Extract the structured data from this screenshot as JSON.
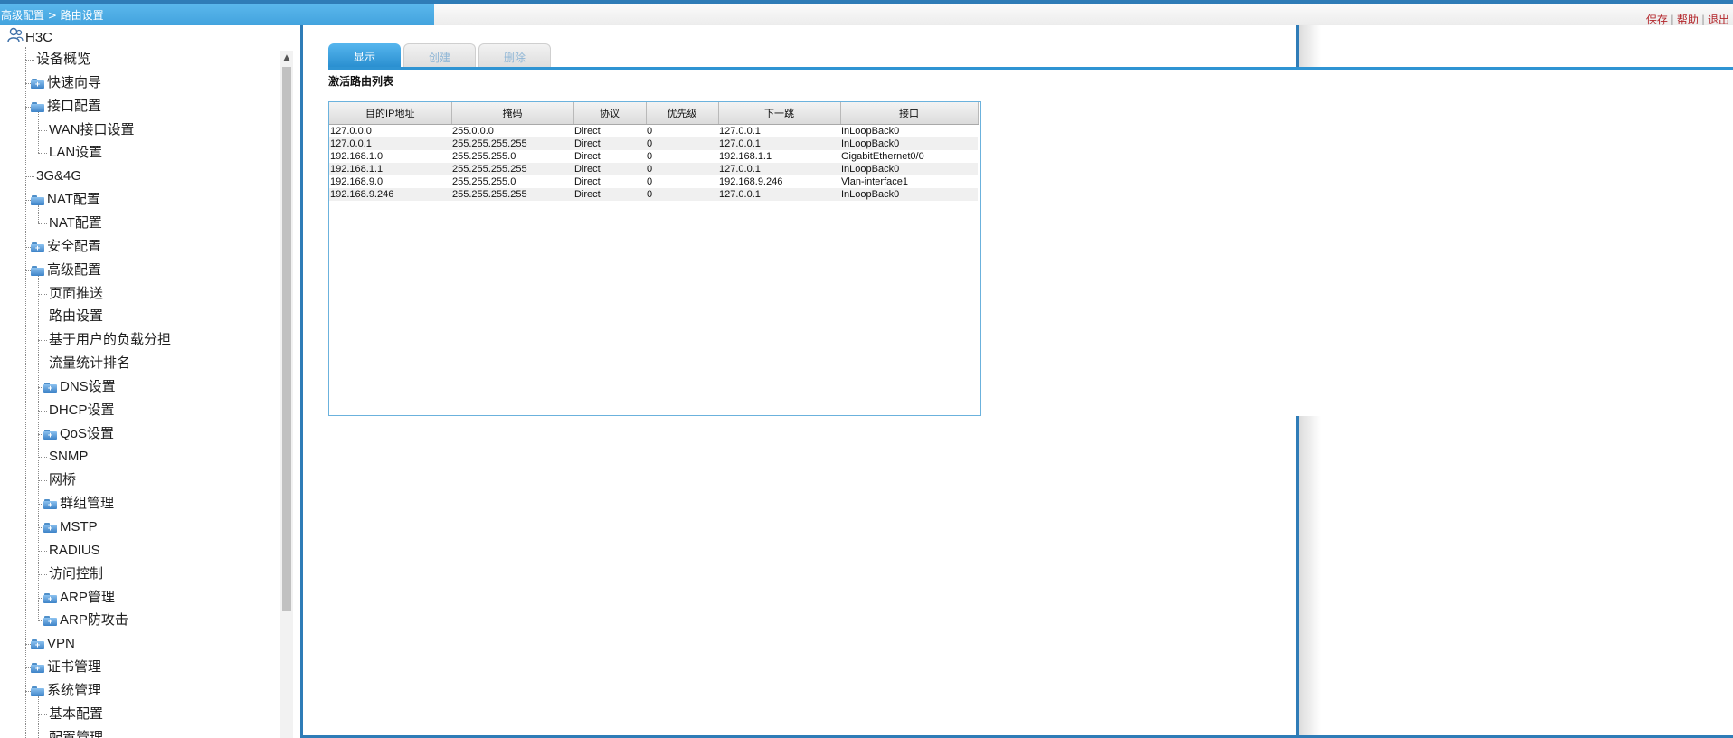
{
  "header": {
    "breadcrumb": "高级配置 > 路由设置",
    "links": [
      "保存",
      "帮助",
      "退出"
    ]
  },
  "sidebar": {
    "root": "H3C",
    "items": [
      {
        "label": "设备概览",
        "level": 1,
        "folder": false
      },
      {
        "label": "快速向导",
        "level": 1,
        "folder": "closed"
      },
      {
        "label": "接口配置",
        "level": 1,
        "folder": "open"
      },
      {
        "label": "WAN接口设置",
        "level": 2,
        "folder": false
      },
      {
        "label": "LAN设置",
        "level": 2,
        "folder": false
      },
      {
        "label": "3G&4G",
        "level": 1,
        "folder": false
      },
      {
        "label": "NAT配置",
        "level": 1,
        "folder": "open"
      },
      {
        "label": "NAT配置",
        "level": 2,
        "folder": false
      },
      {
        "label": "安全配置",
        "level": 1,
        "folder": "closed"
      },
      {
        "label": "高级配置",
        "level": 1,
        "folder": "open"
      },
      {
        "label": "页面推送",
        "level": 2,
        "folder": false
      },
      {
        "label": "路由设置",
        "level": 2,
        "folder": false
      },
      {
        "label": "基于用户的负载分担",
        "level": 2,
        "folder": false
      },
      {
        "label": "流量统计排名",
        "level": 2,
        "folder": false
      },
      {
        "label": "DNS设置",
        "level": 2,
        "folder": "closed"
      },
      {
        "label": "DHCP设置",
        "level": 2,
        "folder": false
      },
      {
        "label": "QoS设置",
        "level": 2,
        "folder": "closed"
      },
      {
        "label": "SNMP",
        "level": 2,
        "folder": false
      },
      {
        "label": "网桥",
        "level": 2,
        "folder": false
      },
      {
        "label": "群组管理",
        "level": 2,
        "folder": "closed"
      },
      {
        "label": "MSTP",
        "level": 2,
        "folder": "closed"
      },
      {
        "label": "RADIUS",
        "level": 2,
        "folder": false
      },
      {
        "label": "访问控制",
        "level": 2,
        "folder": false
      },
      {
        "label": "ARP管理",
        "level": 2,
        "folder": "closed"
      },
      {
        "label": "ARP防攻击",
        "level": 2,
        "folder": "closed"
      },
      {
        "label": "VPN",
        "level": 1,
        "folder": "closed"
      },
      {
        "label": "证书管理",
        "level": 1,
        "folder": "closed"
      },
      {
        "label": "系统管理",
        "level": 1,
        "folder": "open"
      },
      {
        "label": "基本配置",
        "level": 2,
        "folder": false
      },
      {
        "label": "配置管理",
        "level": 2,
        "folder": false
      }
    ]
  },
  "tabs": [
    {
      "label": "显示",
      "active": true
    },
    {
      "label": "创建",
      "active": false
    },
    {
      "label": "删除",
      "active": false
    }
  ],
  "routes": {
    "title": "激活路由列表",
    "columns": [
      "目的IP地址",
      "掩码",
      "协议",
      "优先级",
      "下一跳",
      "接口"
    ],
    "rows": [
      [
        "127.0.0.0",
        "255.0.0.0",
        "Direct",
        "0",
        "127.0.0.1",
        "InLoopBack0"
      ],
      [
        "127.0.0.1",
        "255.255.255.255",
        "Direct",
        "0",
        "127.0.0.1",
        "InLoopBack0"
      ],
      [
        "192.168.1.0",
        "255.255.255.0",
        "Direct",
        "0",
        "192.168.1.1",
        "GigabitEthernet0/0"
      ],
      [
        "192.168.1.1",
        "255.255.255.255",
        "Direct",
        "0",
        "127.0.0.1",
        "InLoopBack0"
      ],
      [
        "192.168.9.0",
        "255.255.255.0",
        "Direct",
        "0",
        "192.168.9.246",
        "Vlan-interface1"
      ],
      [
        "192.168.9.246",
        "255.255.255.255",
        "Direct",
        "0",
        "127.0.0.1",
        "InLoopBack0"
      ]
    ]
  },
  "colors": {
    "accent": "#2f7cb7",
    "tab_active": "#2a8fd0",
    "link": "#b3262b"
  }
}
